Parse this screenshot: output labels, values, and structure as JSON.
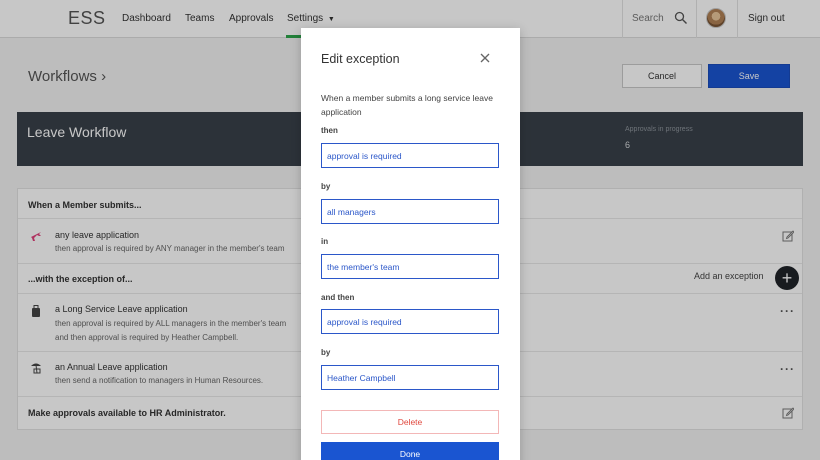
{
  "app": {
    "logo": "ESS"
  },
  "nav": {
    "items": [
      {
        "label": "Dashboard"
      },
      {
        "label": "Teams"
      },
      {
        "label": "Approvals"
      },
      {
        "label": "Settings"
      }
    ],
    "search_label": "Search",
    "signout_label": "Sign out"
  },
  "page": {
    "breadcrumb": "Workflows ›",
    "cancel_label": "Cancel",
    "save_label": "Save"
  },
  "banner": {
    "title": "Leave Workflow",
    "stat_label": "Approvals in progress",
    "stat_value": "6"
  },
  "workflow": {
    "when_header": "When a Member submits...",
    "when_item": {
      "title": "any leave application",
      "line1": "then approval is required by ANY manager in the member's team",
      "icon": "plane-icon"
    },
    "exception_header": "...with the exception of...",
    "add_exception_label": "Add an exception",
    "exceptions": [
      {
        "title": "a Long Service Leave application",
        "line1": "then approval is required by ALL managers in the member's team",
        "line2": "and then approval is required by Heather Campbell.",
        "icon": "suitcase-icon"
      },
      {
        "title": "an Annual Leave application",
        "line1": "then send a notification to managers in Human Resources.",
        "icon": "beach-icon"
      }
    ],
    "hr_row": "Make approvals available to HR Administrator."
  },
  "modal": {
    "title": "Edit exception",
    "description": "When a member submits a long service leave application",
    "fields": [
      {
        "label": "then",
        "value": "approval is required"
      },
      {
        "label": "by",
        "value": "all managers"
      },
      {
        "label": "in",
        "value": "the member's team"
      },
      {
        "label": "and then",
        "value": "approval is required"
      },
      {
        "label": "by",
        "value": "Heather Campbell"
      }
    ],
    "delete_label": "Delete",
    "done_label": "Done"
  },
  "colors": {
    "primary": "#1a55d1",
    "nav_active": "#2ea64b",
    "banner_bg": "#39414a",
    "danger": "#e0483e",
    "accent_icon": "#e0407a"
  }
}
